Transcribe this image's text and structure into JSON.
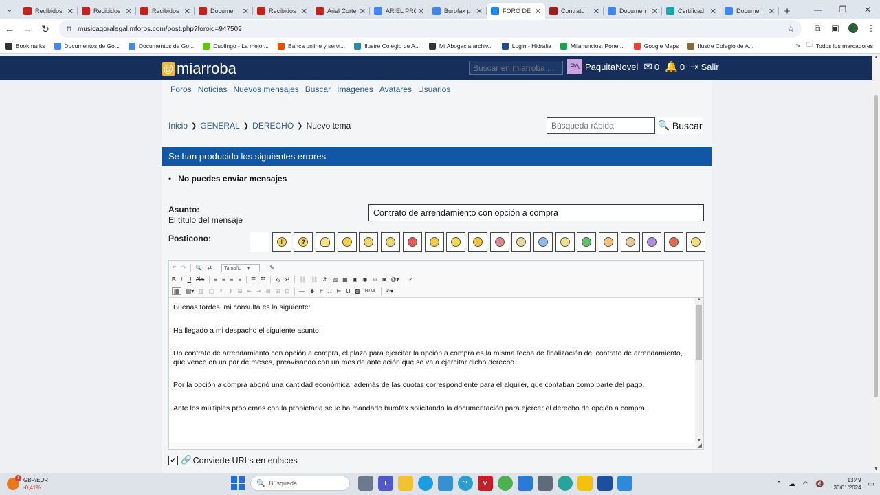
{
  "browser": {
    "tabs": [
      {
        "label": "Recibidos",
        "fav": "#c5221f",
        "active": false
      },
      {
        "label": "Recibidos",
        "fav": "#c5221f",
        "active": false
      },
      {
        "label": "Recibidos",
        "fav": "#c5221f",
        "active": false
      },
      {
        "label": "Documen",
        "fav": "#c5221f",
        "active": false
      },
      {
        "label": "Recibidos",
        "fav": "#c5221f",
        "active": false
      },
      {
        "label": "Ariel Corte",
        "fav": "#c5221f",
        "active": false
      },
      {
        "label": "ARIEL PRO",
        "fav": "#4285f4",
        "active": false
      },
      {
        "label": "Burofax p",
        "fav": "#4285f4",
        "active": false
      },
      {
        "label": "FORO DE",
        "fav": "#1e88e5",
        "active": true
      },
      {
        "label": "Contrato",
        "fav": "#a61b1b",
        "active": false
      },
      {
        "label": "Documen",
        "fav": "#4285f4",
        "active": false
      },
      {
        "label": "Certificad",
        "fav": "#1aa6b7",
        "active": false
      },
      {
        "label": "Documen",
        "fav": "#4285f4",
        "active": false
      }
    ],
    "url": "musicagoralegal.mforos.com/post.php?foroid=947509",
    "bookmarks": [
      {
        "label": "Bookmarks",
        "color": "#333"
      },
      {
        "label": "Documentos de Go...",
        "color": "#4285f4"
      },
      {
        "label": "Documentos de Go...",
        "color": "#4285f4"
      },
      {
        "label": "Duolingo - La mejor...",
        "color": "#58cc02"
      },
      {
        "label": "Banca online y servi...",
        "color": "#e35205"
      },
      {
        "label": "Ilustre Colegio de A...",
        "color": "#2a8ca5"
      },
      {
        "label": "Mi Abogacia archiv...",
        "color": "#333"
      },
      {
        "label": "Login - Hidralia",
        "color": "#1b4d8c"
      },
      {
        "label": "Milanuncios: Poner...",
        "color": "#17a34a"
      },
      {
        "label": "Google Maps",
        "color": "#ea4335"
      },
      {
        "label": "Ilustre Colegio de A...",
        "color": "#8a6b3a"
      }
    ],
    "bookmarks_more": "»",
    "all_bookmarks": "Todos los marcadores"
  },
  "site": {
    "logo": "miarroba",
    "search_placeholder": "Buscar en miarroba ...",
    "user_initials": "PA",
    "username": "PaquitaNovel",
    "messages_count": "0",
    "notifications_count": "0",
    "logout": "Salir",
    "nav": [
      "Foros",
      "Noticias",
      "Nuevos mensajes",
      "Buscar",
      "Imágenes",
      "Avatares",
      "Usuarios"
    ],
    "breadcrumb": [
      "Inicio",
      "GENERAL",
      "DERECHO",
      "Nuevo tema"
    ],
    "quick_search_placeholder": "Búsqueda rápida",
    "quick_search_button": "Buscar",
    "error_title": "Se han producido los siguientes errores",
    "error_item": "No puedes enviar mensajes",
    "subject_label": "Asunto:",
    "subject_sub": "El título del mensaje",
    "subject_value": "Contrato de arrendamiento con opción a compra",
    "posticon_label": "Posticono:",
    "editor": {
      "size_select": "Tamaño",
      "paragraphs": [
        "Buenas tardes, mi consulta es la siguiente:",
        "",
        "Ha llegado a mi despacho el siguiente asunto:",
        "",
        "Un contrato de arrendamiento con opción a compra, el plazo para ejercitar la opción a compra es la misma fecha de finalización del contrato de arrendamiento, que vence en un par de meses, preavisando con un mes de antelación que se va a ejercitar dicho derecho.",
        "",
        "Por la opción a compra abonó una cantidad económica, además de las cuotas correspondiente para el alquiler, que contaban como parte del pago.",
        "",
        "Ante los múltiples problemas con la propietaria se le ha mandado burofax solicitando la documentación para ejercer el derecho de opción a compra"
      ]
    },
    "convert_urls": "Convierte URLs en enlaces"
  },
  "taskbar": {
    "ticker_name": "GBP/EUR",
    "ticker_change": "-0,41%",
    "badge": "1",
    "search_placeholder": "Búsqueda",
    "time": "13:49",
    "date": "30/01/2024"
  }
}
